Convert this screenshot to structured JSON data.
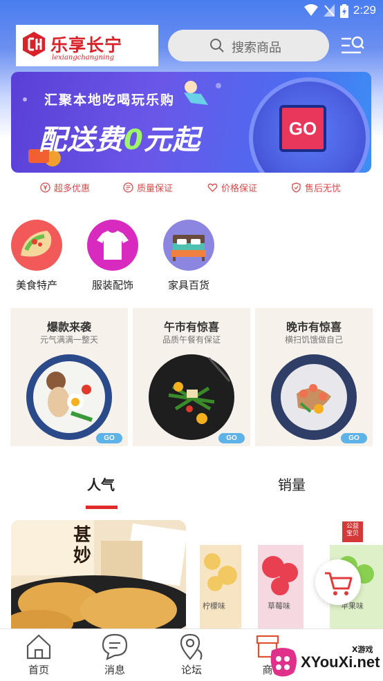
{
  "status_bar": {
    "time": "2:29"
  },
  "header": {
    "logo_text": "乐享长宁",
    "logo_subtext": "lexiangchangning",
    "search_placeholder": "搜索商品"
  },
  "banner": {
    "tagline": "汇聚本地吃喝玩乐购",
    "headline_prefix": "配送费",
    "headline_zero": "0",
    "headline_suffix": "元起",
    "go_label": "GO"
  },
  "guarantees": [
    {
      "label": "超多优惠",
      "icon": "yen-coin-icon"
    },
    {
      "label": "质量保证",
      "icon": "certificate-icon"
    },
    {
      "label": "价格保证",
      "icon": "heart-icon"
    },
    {
      "label": "售后无忧",
      "icon": "shield-icon"
    }
  ],
  "categories": [
    {
      "label": "美食特产",
      "icon": "food-wrap-icon"
    },
    {
      "label": "服装配饰",
      "icon": "tshirt-icon"
    },
    {
      "label": "家具百货",
      "icon": "bed-icon"
    }
  ],
  "promos": [
    {
      "title": "爆款来袭",
      "subtitle": "元气满满一整天",
      "go": "GO"
    },
    {
      "title": "午市有惊喜",
      "subtitle": "品质午餐有保证",
      "go": "GO"
    },
    {
      "title": "晚市有惊喜",
      "subtitle": "横扫饥饿做自己",
      "go": "GO"
    }
  ],
  "tabs": [
    {
      "label": "人气",
      "active": true
    },
    {
      "label": "销量",
      "active": false
    }
  ],
  "product_right": {
    "badge": "公益\n宝贝",
    "flavors": [
      "柠檬味",
      "草莓味",
      "苹果味"
    ]
  },
  "bottom_nav": [
    {
      "label": "首页",
      "icon": "home-icon"
    },
    {
      "label": "消息",
      "icon": "chat-icon"
    },
    {
      "label": "论坛",
      "icon": "location-pin-icon"
    },
    {
      "label": "商",
      "icon": "store-icon"
    }
  ],
  "watermark": {
    "text": "XYouXi.net",
    "small": "X游戏"
  },
  "colors": {
    "accent_red": "#e02a2a",
    "brand_red": "#d9222a",
    "banner_purple": "#5a3fd6"
  }
}
